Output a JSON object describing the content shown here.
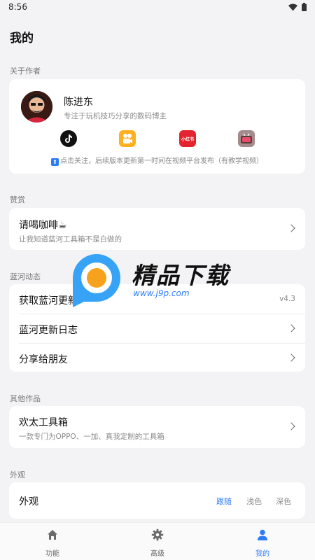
{
  "status_bar": {
    "time": "8:56"
  },
  "page_title": "我的",
  "about": {
    "section_label": "关于作者",
    "name": "陈进东",
    "description": "专注于玩机技巧分享的数码博主",
    "platforms": [
      "tiktok-icon",
      "kuaishou-icon",
      "xiaohongshu-icon",
      "bilibili-icon"
    ],
    "notice_arrow": "⬆",
    "notice": "点击关注，后续版本更新第一时间在视频平台发布（有教学视频）"
  },
  "reward": {
    "section_label": "赞赏",
    "title": "请喝咖啡☕",
    "subtitle": "让我知道蓝河工具箱不是白做的"
  },
  "updates": {
    "section_label": "蓝河动态",
    "items": [
      {
        "label": "获取蓝河更新",
        "value": "v4.3"
      },
      {
        "label": "蓝河更新日志"
      },
      {
        "label": "分享给朋友"
      }
    ]
  },
  "other": {
    "section_label": "其他作品",
    "title": "欢太工具箱",
    "subtitle": "一款专门为OPPO、一加、真我定制的工具箱"
  },
  "appearance": {
    "section_label": "外观",
    "title": "外观",
    "options": [
      "跟随",
      "浅色",
      "深色"
    ],
    "selected": "跟随"
  },
  "watermark": {
    "title": "精品下载",
    "url": "www.j9p.com"
  },
  "bottom_nav": [
    {
      "label": "功能",
      "icon": "home-icon"
    },
    {
      "label": "高级",
      "icon": "gear-icon"
    },
    {
      "label": "我的",
      "icon": "person-icon",
      "active": true
    }
  ],
  "colors": {
    "accent": "#2f7df6",
    "background": "#f3f3f6",
    "card": "#ffffff"
  }
}
